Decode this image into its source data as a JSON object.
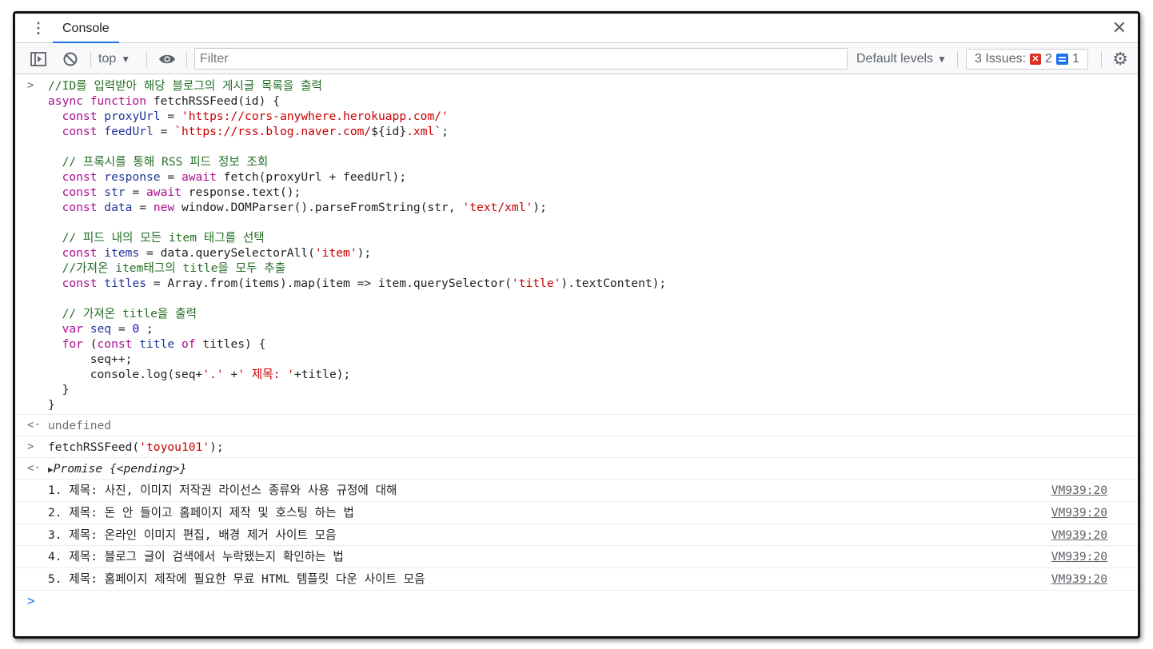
{
  "tabbar": {
    "tab_label": "Console",
    "close_glyph": "✕"
  },
  "toolbar": {
    "context": "top",
    "filter_placeholder": "Filter",
    "levels": "Default levels",
    "issues_label": "3 Issues:",
    "issues_errors": "2",
    "issues_info": "1"
  },
  "icons": [
    "kebab-menu-icon",
    "sidebar-toggle-icon",
    "clear-console-icon",
    "eye-icon",
    "close-icon",
    "error-icon",
    "info-icon",
    "gear-icon"
  ],
  "colors": {
    "accent": "#1a73e8",
    "error": "#d93025",
    "comment": "#236e25",
    "keyword": "#aa0d91",
    "string": "#c80000",
    "variable": "#1d3596"
  },
  "console": {
    "input_prompt": ">",
    "output_prompt": "<·",
    "code_lines": [
      [
        {
          "t": "//ID를 입력받아 해당 블로그의 게시글 목록을 출력",
          "c": "c-comment"
        }
      ],
      [
        {
          "t": "async function ",
          "c": "c-kw"
        },
        {
          "t": "fetchRSSFeed(id) {",
          "c": "c-plain"
        }
      ],
      [
        {
          "t": "  const ",
          "c": "c-kw"
        },
        {
          "t": "proxyUrl",
          "c": "c-var"
        },
        {
          "t": " = ",
          "c": "c-plain"
        },
        {
          "t": "'https://cors-anywhere.herokuapp.com/'",
          "c": "c-str"
        }
      ],
      [
        {
          "t": "  const ",
          "c": "c-kw"
        },
        {
          "t": "feedUrl",
          "c": "c-var"
        },
        {
          "t": " = ",
          "c": "c-plain"
        },
        {
          "t": "`https://rss.blog.naver.com/",
          "c": "c-str"
        },
        {
          "t": "${id}",
          "c": "c-plain"
        },
        {
          "t": ".xml`",
          "c": "c-str"
        },
        {
          "t": ";",
          "c": "c-plain"
        }
      ],
      [
        {
          "t": "",
          "c": "c-plain"
        }
      ],
      [
        {
          "t": "  // 프록시를 통해 RSS 피드 정보 조회",
          "c": "c-comment"
        }
      ],
      [
        {
          "t": "  const ",
          "c": "c-kw"
        },
        {
          "t": "response",
          "c": "c-var"
        },
        {
          "t": " = ",
          "c": "c-plain"
        },
        {
          "t": "await ",
          "c": "c-kw"
        },
        {
          "t": "fetch(proxyUrl + feedUrl);",
          "c": "c-plain"
        }
      ],
      [
        {
          "t": "  const ",
          "c": "c-kw"
        },
        {
          "t": "str",
          "c": "c-var"
        },
        {
          "t": " = ",
          "c": "c-plain"
        },
        {
          "t": "await ",
          "c": "c-kw"
        },
        {
          "t": "response.text();",
          "c": "c-plain"
        }
      ],
      [
        {
          "t": "  const ",
          "c": "c-kw"
        },
        {
          "t": "data",
          "c": "c-var"
        },
        {
          "t": " = ",
          "c": "c-plain"
        },
        {
          "t": "new ",
          "c": "c-kw"
        },
        {
          "t": "window.DOMParser().parseFromString(str, ",
          "c": "c-plain"
        },
        {
          "t": "'text/xml'",
          "c": "c-str"
        },
        {
          "t": ");",
          "c": "c-plain"
        }
      ],
      [
        {
          "t": "",
          "c": "c-plain"
        }
      ],
      [
        {
          "t": "  // 피드 내의 모든 item 태그를 선택",
          "c": "c-comment"
        }
      ],
      [
        {
          "t": "  const ",
          "c": "c-kw"
        },
        {
          "t": "items",
          "c": "c-var"
        },
        {
          "t": " = ",
          "c": "c-plain"
        },
        {
          "t": "data.querySelectorAll(",
          "c": "c-plain"
        },
        {
          "t": "'item'",
          "c": "c-str"
        },
        {
          "t": ");",
          "c": "c-plain"
        }
      ],
      [
        {
          "t": "  //가져온 item태그의 title을 모두 추출",
          "c": "c-comment"
        }
      ],
      [
        {
          "t": "  const ",
          "c": "c-kw"
        },
        {
          "t": "titles",
          "c": "c-var"
        },
        {
          "t": " = ",
          "c": "c-plain"
        },
        {
          "t": "Array.from(items).map(item => item.querySelector(",
          "c": "c-plain"
        },
        {
          "t": "'title'",
          "c": "c-str"
        },
        {
          "t": ").textContent);",
          "c": "c-plain"
        }
      ],
      [
        {
          "t": "",
          "c": "c-plain"
        }
      ],
      [
        {
          "t": "  // 가져온 title을 출력",
          "c": "c-comment"
        }
      ],
      [
        {
          "t": "  var ",
          "c": "c-kw"
        },
        {
          "t": "seq",
          "c": "c-var"
        },
        {
          "t": " = ",
          "c": "c-plain"
        },
        {
          "t": "0",
          "c": "c-num"
        },
        {
          "t": " ;",
          "c": "c-plain"
        }
      ],
      [
        {
          "t": "  for ",
          "c": "c-kw"
        },
        {
          "t": "(",
          "c": "c-plain"
        },
        {
          "t": "const ",
          "c": "c-kw"
        },
        {
          "t": "title",
          "c": "c-var"
        },
        {
          "t": " of ",
          "c": "c-kw"
        },
        {
          "t": "titles) {",
          "c": "c-plain"
        }
      ],
      [
        {
          "t": "      seq++;",
          "c": "c-plain"
        }
      ],
      [
        {
          "t": "      console.log(seq+",
          "c": "c-plain"
        },
        {
          "t": "'.'",
          "c": "c-str"
        },
        {
          "t": " +",
          "c": "c-plain"
        },
        {
          "t": "' 제목: '",
          "c": "c-str"
        },
        {
          "t": "+title);",
          "c": "c-plain"
        }
      ],
      [
        {
          "t": "  }",
          "c": "c-plain"
        }
      ],
      [
        {
          "t": "}",
          "c": "c-plain"
        }
      ]
    ],
    "undefined_text": "undefined",
    "call_parts": [
      {
        "t": "fetchRSSFeed(",
        "c": "c-plain"
      },
      {
        "t": "'toyou101'",
        "c": "c-str"
      },
      {
        "t": ");",
        "c": "c-plain"
      }
    ],
    "promise_text": "Promise {<pending>}",
    "logs": [
      {
        "text": "1. 제목: 사진, 이미지 저작권 라이선스 종류와 사용 규정에 대해",
        "source": "VM939:20"
      },
      {
        "text": "2. 제목: 돈 안 들이고 홈페이지 제작 및 호스팅 하는 법",
        "source": "VM939:20"
      },
      {
        "text": "3. 제목: 온라인 이미지 편집, 배경 제거 사이트 모음",
        "source": "VM939:20"
      },
      {
        "text": "4. 제목: 블로그 글이 검색에서 누락됐는지 확인하는 법",
        "source": "VM939:20"
      },
      {
        "text": "5. 제목: 홈페이지 제작에 필요한 무료 HTML 템플릿 다운 사이트 모음",
        "source": "VM939:20"
      }
    ]
  }
}
